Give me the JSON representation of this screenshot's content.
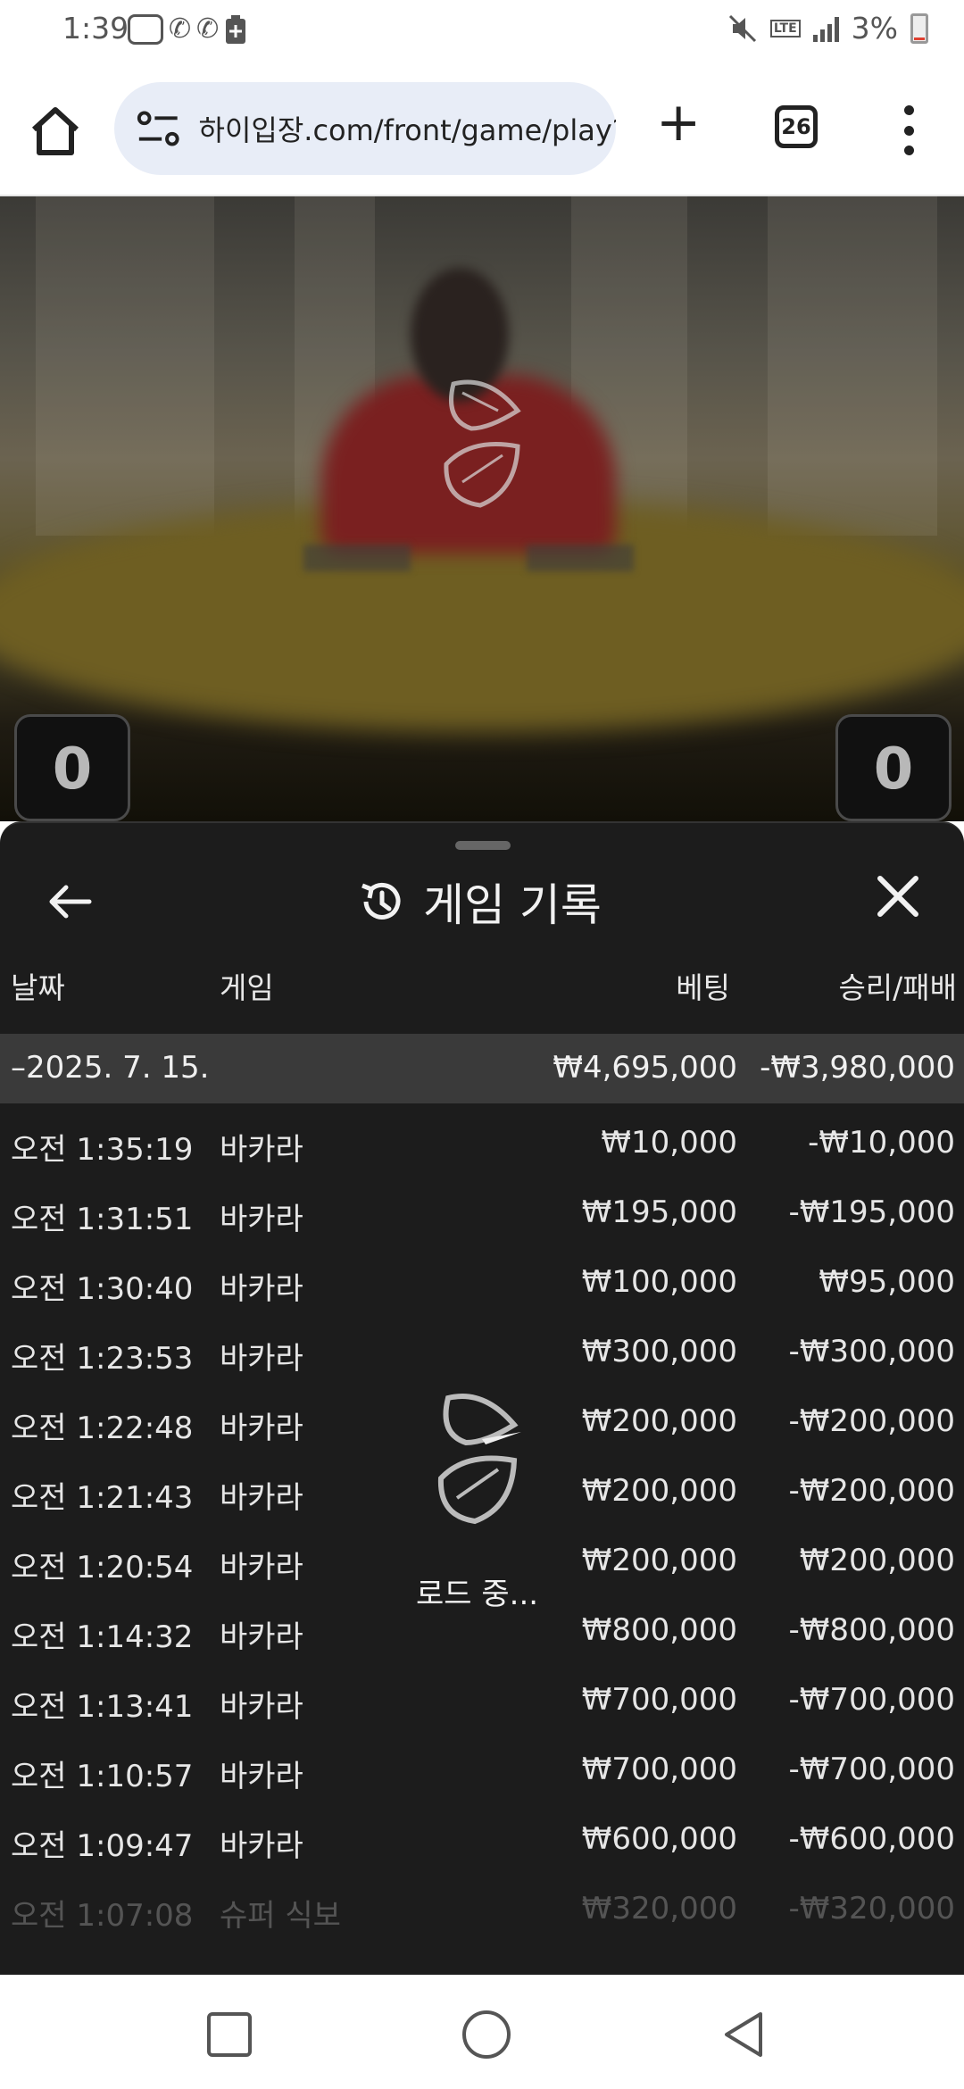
{
  "status_bar": {
    "time": "1:39",
    "battery_percent": "3%",
    "network": "LTE",
    "icons": [
      "carrier-badge-icon",
      "wifi-call-icon",
      "wifi-call-icon",
      "battery-plus-icon",
      "mute-icon",
      "lte-icon",
      "signal-icon",
      "battery-icon"
    ]
  },
  "browser": {
    "url": "하이입장.com/front/game/play?",
    "tab_count": "26",
    "icons": [
      "home-icon",
      "site-settings-icon",
      "new-tab-icon",
      "tabs-icon",
      "menu-icon"
    ]
  },
  "video": {
    "score_left": "0",
    "score_right": "0"
  },
  "sheet": {
    "title": "게임 기록",
    "columns": {
      "date": "날짜",
      "game": "게임",
      "bet": "베팅",
      "result": "승리/패배"
    },
    "summary": {
      "date": "–2025. 7. 15.",
      "bet": "₩4,695,000",
      "result": "-₩3,980,000"
    },
    "rows": [
      {
        "time": "오전 1:35:19",
        "game": "바카라",
        "bet": "₩10,000",
        "result": "-₩10,000"
      },
      {
        "time": "오전 1:31:51",
        "game": "바카라",
        "bet": "₩195,000",
        "result": "-₩195,000"
      },
      {
        "time": "오전 1:30:40",
        "game": "바카라",
        "bet": "₩100,000",
        "result": "₩95,000"
      },
      {
        "time": "오전 1:23:53",
        "game": "바카라",
        "bet": "₩300,000",
        "result": "-₩300,000"
      },
      {
        "time": "오전 1:22:48",
        "game": "바카라",
        "bet": "₩200,000",
        "result": "-₩200,000"
      },
      {
        "time": "오전 1:21:43",
        "game": "바카라",
        "bet": "₩200,000",
        "result": "-₩200,000"
      },
      {
        "time": "오전 1:20:54",
        "game": "바카라",
        "bet": "₩200,000",
        "result": "₩200,000"
      },
      {
        "time": "오전 1:14:32",
        "game": "바카라",
        "bet": "₩800,000",
        "result": "-₩800,000"
      },
      {
        "time": "오전 1:13:41",
        "game": "바카라",
        "bet": "₩700,000",
        "result": "-₩700,000"
      },
      {
        "time": "오전 1:10:57",
        "game": "바카라",
        "bet": "₩700,000",
        "result": "-₩700,000"
      },
      {
        "time": "오전 1:09:47",
        "game": "바카라",
        "bet": "₩600,000",
        "result": "-₩600,000"
      },
      {
        "time": "오전 1:07:08",
        "game": "슈퍼 식보",
        "bet": "₩320,000",
        "result": "-₩320,000"
      }
    ],
    "loading_text": "로드 중..."
  },
  "nav_bar": {
    "icons": [
      "recent-apps-icon",
      "home-circle-icon",
      "back-triangle-icon"
    ]
  }
}
